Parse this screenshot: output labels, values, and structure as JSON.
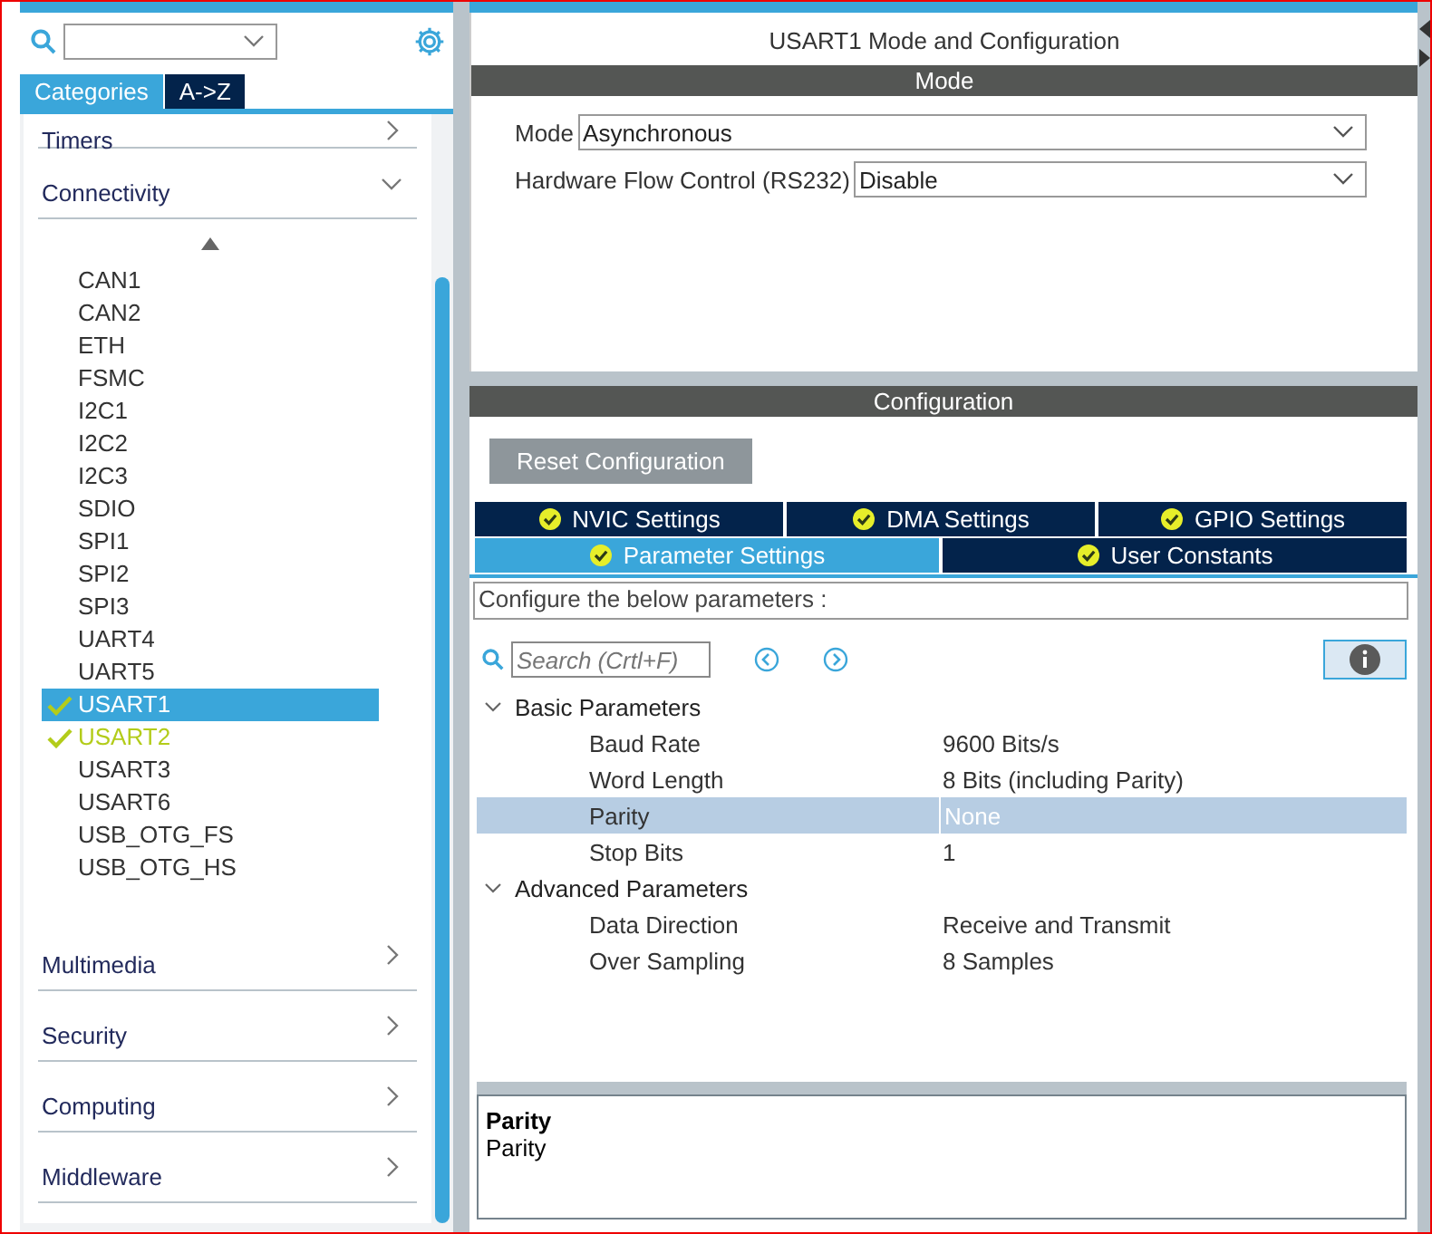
{
  "sidebar": {
    "tabs": [
      {
        "label": "Categories",
        "selected": true
      },
      {
        "label": "A->Z",
        "selected": false
      }
    ],
    "categories": [
      {
        "label": "Timers",
        "expanded": false
      },
      {
        "label": "Connectivity",
        "expanded": true,
        "items": [
          {
            "label": "CAN1",
            "selected": false,
            "checked": false
          },
          {
            "label": "CAN2",
            "selected": false,
            "checked": false
          },
          {
            "label": "ETH",
            "selected": false,
            "checked": false
          },
          {
            "label": "FSMC",
            "selected": false,
            "checked": false
          },
          {
            "label": "I2C1",
            "selected": false,
            "checked": false
          },
          {
            "label": "I2C2",
            "selected": false,
            "checked": false
          },
          {
            "label": "I2C3",
            "selected": false,
            "checked": false
          },
          {
            "label": "SDIO",
            "selected": false,
            "checked": false
          },
          {
            "label": "SPI1",
            "selected": false,
            "checked": false
          },
          {
            "label": "SPI2",
            "selected": false,
            "checked": false
          },
          {
            "label": "SPI3",
            "selected": false,
            "checked": false
          },
          {
            "label": "UART4",
            "selected": false,
            "checked": false
          },
          {
            "label": "UART5",
            "selected": false,
            "checked": false
          },
          {
            "label": "USART1",
            "selected": true,
            "checked": true
          },
          {
            "label": "USART2",
            "selected": false,
            "checked": true
          },
          {
            "label": "USART3",
            "selected": false,
            "checked": false
          },
          {
            "label": "USART6",
            "selected": false,
            "checked": false
          },
          {
            "label": "USB_OTG_FS",
            "selected": false,
            "checked": false
          },
          {
            "label": "USB_OTG_HS",
            "selected": false,
            "checked": false
          }
        ]
      },
      {
        "label": "Multimedia",
        "expanded": false
      },
      {
        "label": "Security",
        "expanded": false
      },
      {
        "label": "Computing",
        "expanded": false
      },
      {
        "label": "Middleware",
        "expanded": false
      }
    ]
  },
  "main": {
    "title": "USART1 Mode and Configuration",
    "mode_header": "Mode",
    "mode_fields": [
      {
        "label": "Mode",
        "value": "Asynchronous"
      },
      {
        "label": "Hardware Flow Control (RS232)",
        "value": "Disable"
      }
    ],
    "config_header": "Configuration",
    "reset_button": "Reset Configuration",
    "tab_rows": [
      [
        {
          "label": "NVIC Settings",
          "selected": false
        },
        {
          "label": "DMA Settings",
          "selected": false
        },
        {
          "label": "GPIO Settings",
          "selected": false
        }
      ],
      [
        {
          "label": "Parameter Settings",
          "selected": true
        },
        {
          "label": "User Constants",
          "selected": false
        }
      ]
    ],
    "hint": "Configure the below parameters :",
    "search": {
      "placeholder": "Search (Crtl+F)"
    },
    "groups": [
      {
        "label": "Basic Parameters",
        "expanded": true,
        "rows": [
          {
            "name": "Baud Rate",
            "value": "9600 Bits/s",
            "selected": false
          },
          {
            "name": "Word Length",
            "value": "8 Bits (including Parity)",
            "selected": false
          },
          {
            "name": "Parity",
            "value": "None",
            "selected": true
          },
          {
            "name": "Stop Bits",
            "value": "1",
            "selected": false
          }
        ]
      },
      {
        "label": "Advanced Parameters",
        "expanded": true,
        "rows": [
          {
            "name": "Data Direction",
            "value": "Receive and Transmit",
            "selected": false
          },
          {
            "name": "Over Sampling",
            "value": "8 Samples",
            "selected": false
          }
        ]
      }
    ],
    "description": {
      "title": "Parity",
      "text": "Parity"
    }
  }
}
